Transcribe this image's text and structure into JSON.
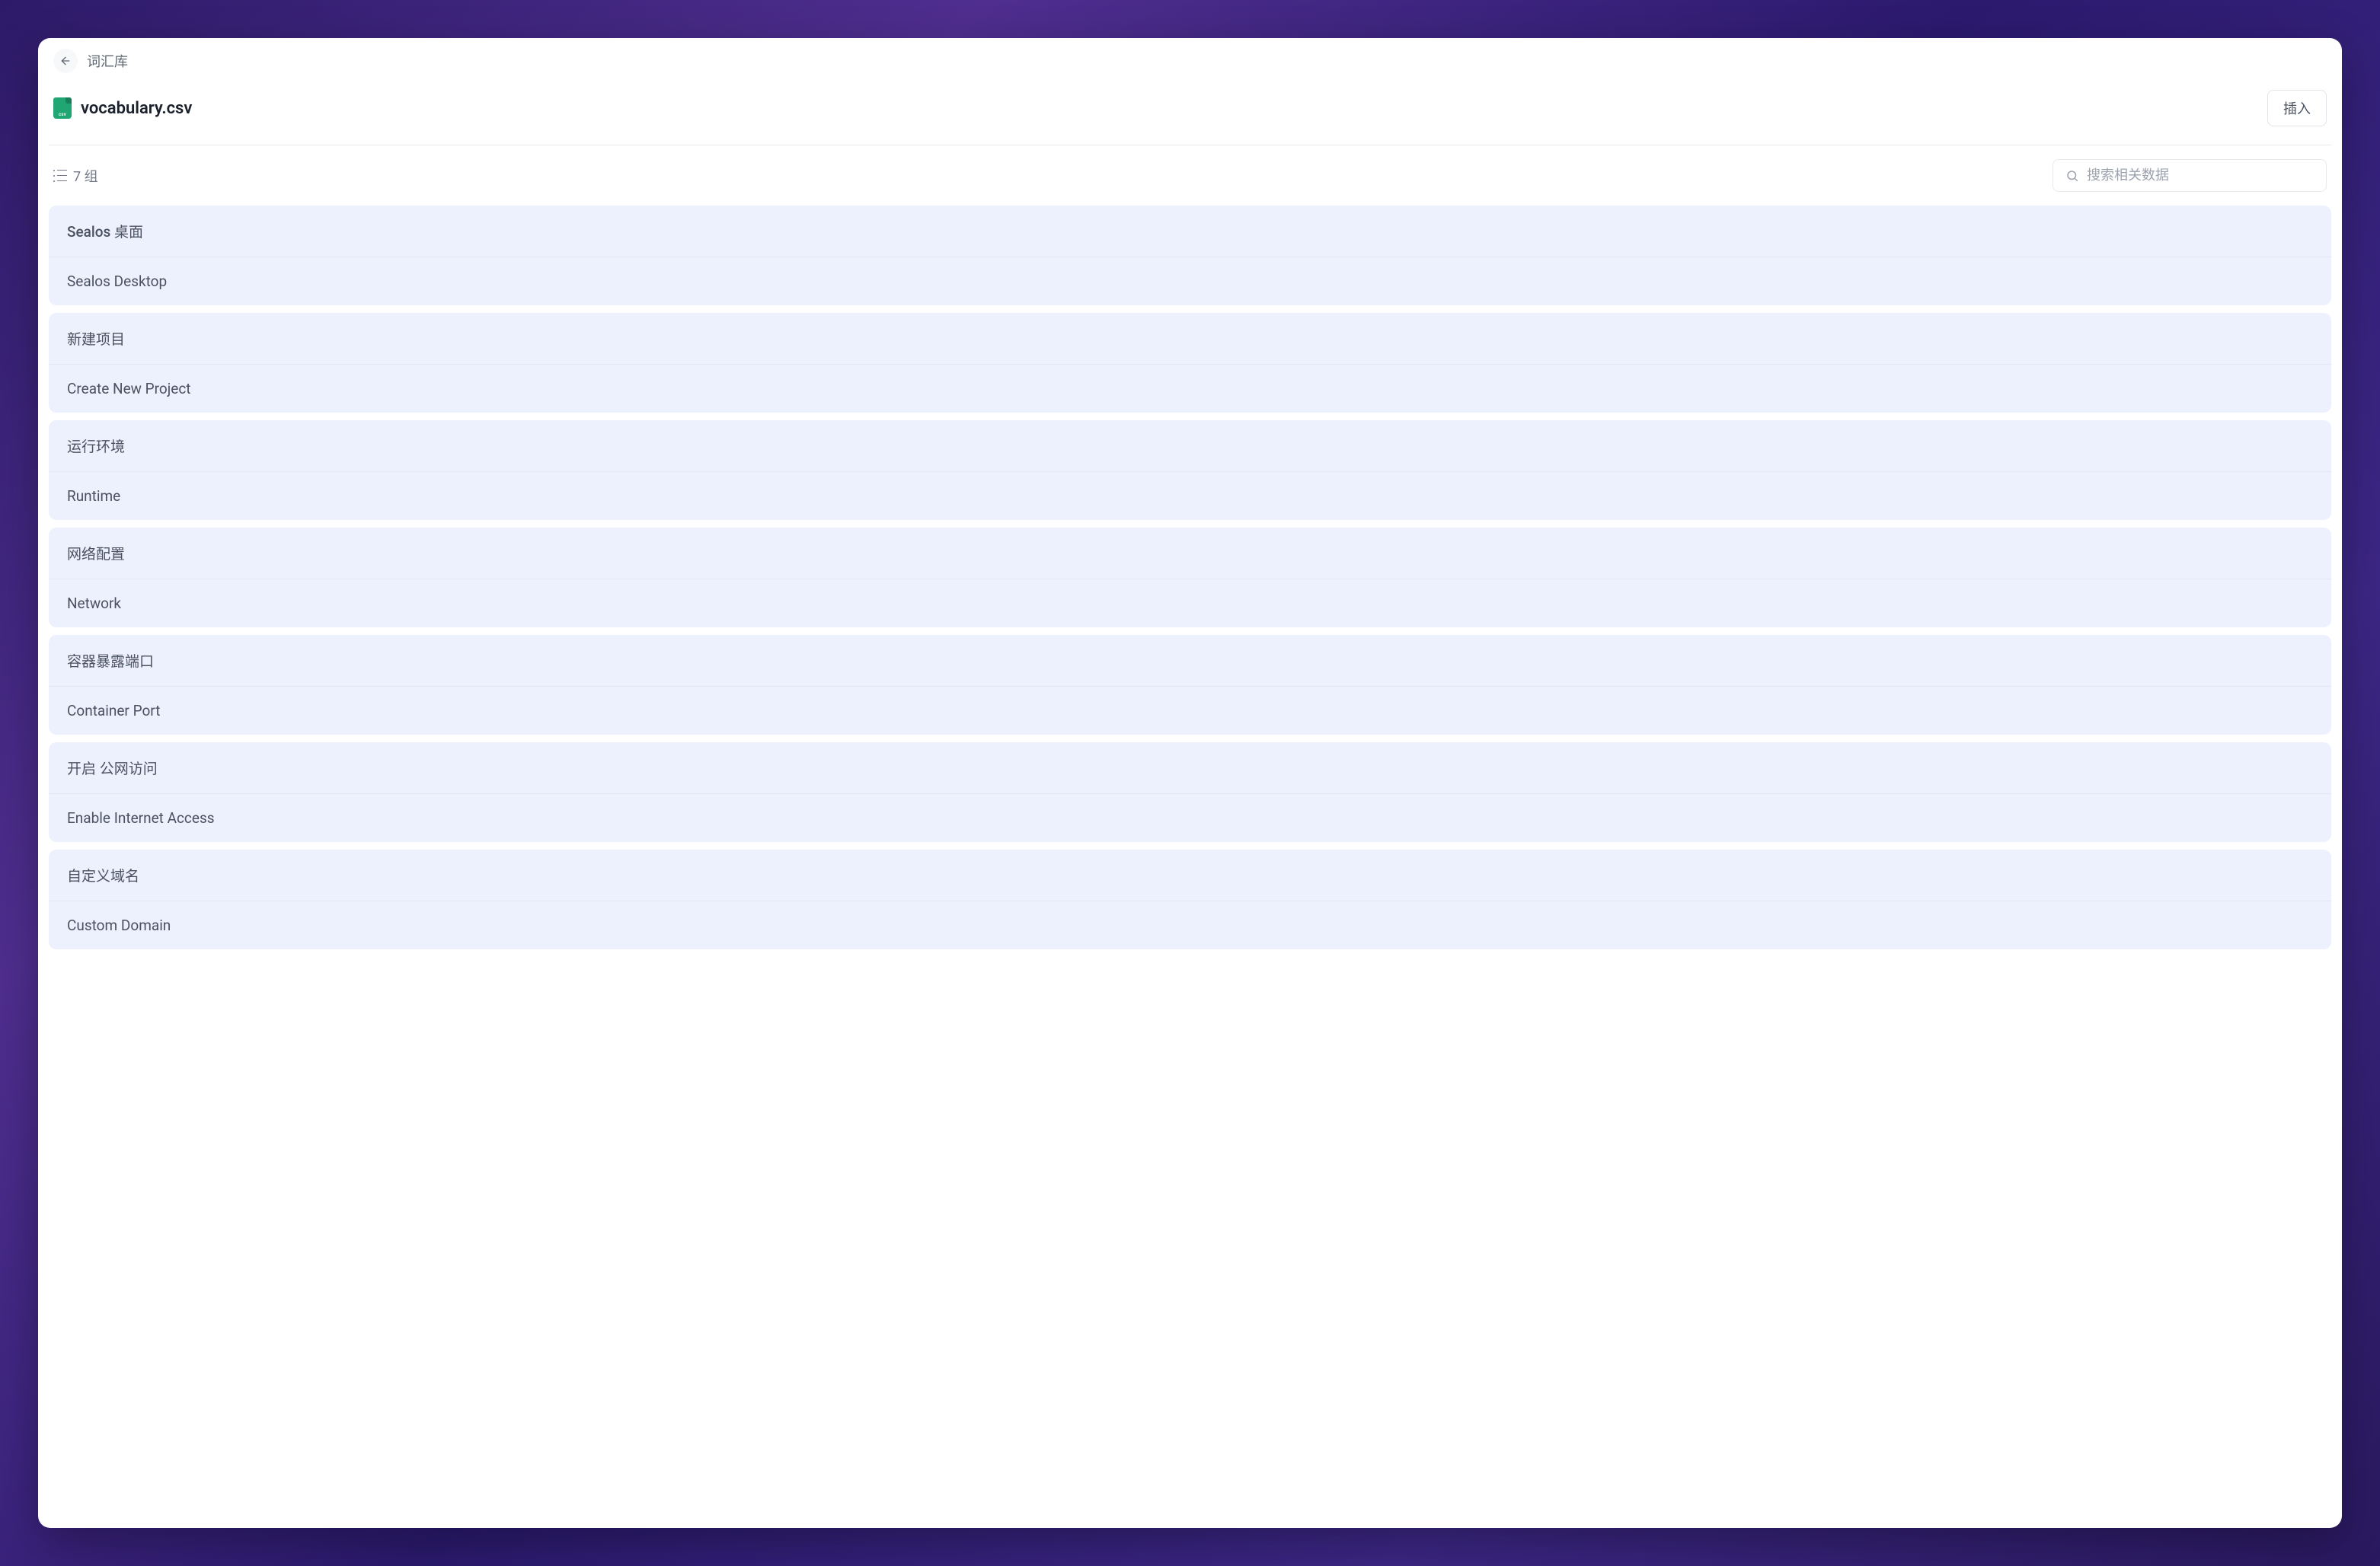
{
  "header": {
    "breadcrumb": "词汇库",
    "file_name": "vocabulary.csv",
    "insert_button": "插入"
  },
  "controls": {
    "group_count": "7 组",
    "search_placeholder": "搜索相关数据"
  },
  "groups": [
    {
      "source": "Sealos 桌面",
      "target": "Sealos Desktop"
    },
    {
      "source": "新建项目",
      "target": "Create New Project"
    },
    {
      "source": "运行环境",
      "target": "Runtime"
    },
    {
      "source": "网络配置",
      "target": "Network"
    },
    {
      "source": "容器暴露端口",
      "target": "Container Port"
    },
    {
      "source": "开启 公网访问",
      "target": "Enable Internet Access"
    },
    {
      "source": "自定义域名",
      "target": "Custom Domain"
    }
  ]
}
